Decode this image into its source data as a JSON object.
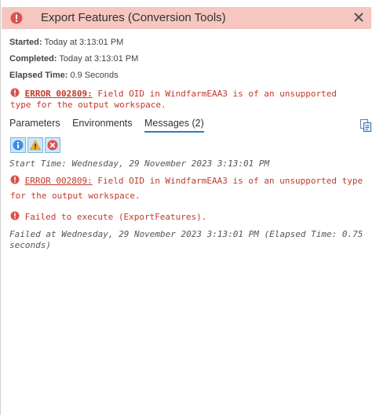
{
  "header": {
    "title": "Export Features (Conversion Tools)"
  },
  "meta": {
    "started_label": "Started:",
    "started_value": "Today at 3:13:01 PM",
    "completed_label": "Completed:",
    "completed_value": "Today at 3:13:01 PM",
    "elapsed_label": "Elapsed Time:",
    "elapsed_value": "0.9 Seconds"
  },
  "summary_error": {
    "code": "ERROR 002809:",
    "text_line1": " Field OID in WindfarmEAA3 is of an unsupported",
    "text_line2": "type for the output workspace."
  },
  "tabs": [
    {
      "label": "Parameters"
    },
    {
      "label": "Environments"
    },
    {
      "label": "Messages (2)"
    }
  ],
  "messages": {
    "start_time": "Start Time: Wednesday, 29 November 2023 3:13:01 PM",
    "error_code": "ERROR 002809:",
    "error_text_line1": " Field OID in WindfarmEAA3 is of an unsupported type",
    "error_text_line2": "for the output workspace.",
    "failed": "Failed to execute (ExportFeatures).",
    "failed_at_line1": "Failed at Wednesday, 29 November 2023 3:13:01 PM (Elapsed Time: 0.75",
    "failed_at_line2": "seconds)"
  },
  "colors": {
    "header_bg": "#f6c6c0",
    "error_red": "#c0392b",
    "tab_underline": "#2d7bbf"
  }
}
